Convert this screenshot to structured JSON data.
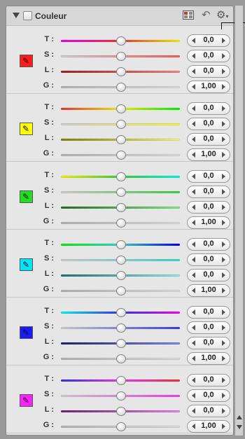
{
  "header": {
    "title": "Couleur",
    "undo_icon": "↶",
    "gear_icon": "⚙",
    "gear_caret": "▾"
  },
  "groups": [
    {
      "color": "#ff1a1a",
      "dropper": "✎",
      "rows": [
        {
          "label": "T :",
          "value": "0,0",
          "track": "linear-gradient(90deg,#ff00ff,#ff3333,#ffff00)"
        },
        {
          "label": "S :",
          "value": "0,0",
          "track": "linear-gradient(90deg,#d8d8d8,#ff6060)"
        },
        {
          "label": "L :",
          "value": "0,0",
          "track": "linear-gradient(90deg,#aa2222,#ff8888)"
        },
        {
          "label": "G :",
          "value": "1,00",
          "track": "linear-gradient(90deg,#bdbdbd,#e5e5e5)"
        }
      ]
    },
    {
      "color": "#ffff00",
      "dropper": "✎",
      "rows": [
        {
          "label": "T :",
          "value": "0,0",
          "track": "linear-gradient(90deg,#ff3333,#ffff00,#00ff00)"
        },
        {
          "label": "S :",
          "value": "0,0",
          "track": "linear-gradient(90deg,#d8d8d8,#ffff40)"
        },
        {
          "label": "L :",
          "value": "0,0",
          "track": "linear-gradient(90deg,#888800,#ffff88)"
        },
        {
          "label": "G :",
          "value": "1,00",
          "track": "linear-gradient(90deg,#bdbdbd,#e5e5e5)"
        }
      ]
    },
    {
      "color": "#22dd22",
      "dropper": "✎",
      "rows": [
        {
          "label": "T :",
          "value": "0,0",
          "track": "linear-gradient(90deg,#ffff00,#33dd33,#00ffff)"
        },
        {
          "label": "S :",
          "value": "0,0",
          "track": "linear-gradient(90deg,#d8d8d8,#40dd40)"
        },
        {
          "label": "L :",
          "value": "0,0",
          "track": "linear-gradient(90deg,#227722,#88ee88)"
        },
        {
          "label": "G :",
          "value": "1,00",
          "track": "linear-gradient(90deg,#bdbdbd,#e5e5e5)"
        }
      ]
    },
    {
      "color": "#00e5ff",
      "dropper": "✎",
      "rows": [
        {
          "label": "T :",
          "value": "0,0",
          "track": "linear-gradient(90deg,#00ff00,#33dddd,#0000ff)"
        },
        {
          "label": "S :",
          "value": "0,0",
          "track": "linear-gradient(90deg,#d8d8d8,#40e0e0)"
        },
        {
          "label": "L :",
          "value": "0,0",
          "track": "linear-gradient(90deg,#227777,#99eeee)"
        },
        {
          "label": "G :",
          "value": "1,00",
          "track": "linear-gradient(90deg,#bdbdbd,#e5e5e5)"
        }
      ]
    },
    {
      "color": "#1a1aff",
      "dropper": "✎",
      "rows": [
        {
          "label": "T :",
          "value": "0,0",
          "track": "linear-gradient(90deg,#00ffff,#3333ff,#ff00ff)"
        },
        {
          "label": "S :",
          "value": "0,0",
          "track": "linear-gradient(90deg,#d8d8d8,#4040ff)"
        },
        {
          "label": "L :",
          "value": "0,0",
          "track": "linear-gradient(90deg,#222277,#8888ee)"
        },
        {
          "label": "G :",
          "value": "1,00",
          "track": "linear-gradient(90deg,#bdbdbd,#e5e5e5)"
        }
      ]
    },
    {
      "color": "#ff22ff",
      "dropper": "✎",
      "rows": [
        {
          "label": "T :",
          "value": "0,0",
          "track": "linear-gradient(90deg,#3333ff,#ff33ff,#ff3333)"
        },
        {
          "label": "S :",
          "value": "0,0",
          "track": "linear-gradient(90deg,#d8d8d8,#ff40ff)"
        },
        {
          "label": "L :",
          "value": "0,0",
          "track": "linear-gradient(90deg,#772277,#ee88ee)"
        },
        {
          "label": "G :",
          "value": "1,00",
          "track": "linear-gradient(90deg,#bdbdbd,#e5e5e5)"
        }
      ]
    }
  ]
}
